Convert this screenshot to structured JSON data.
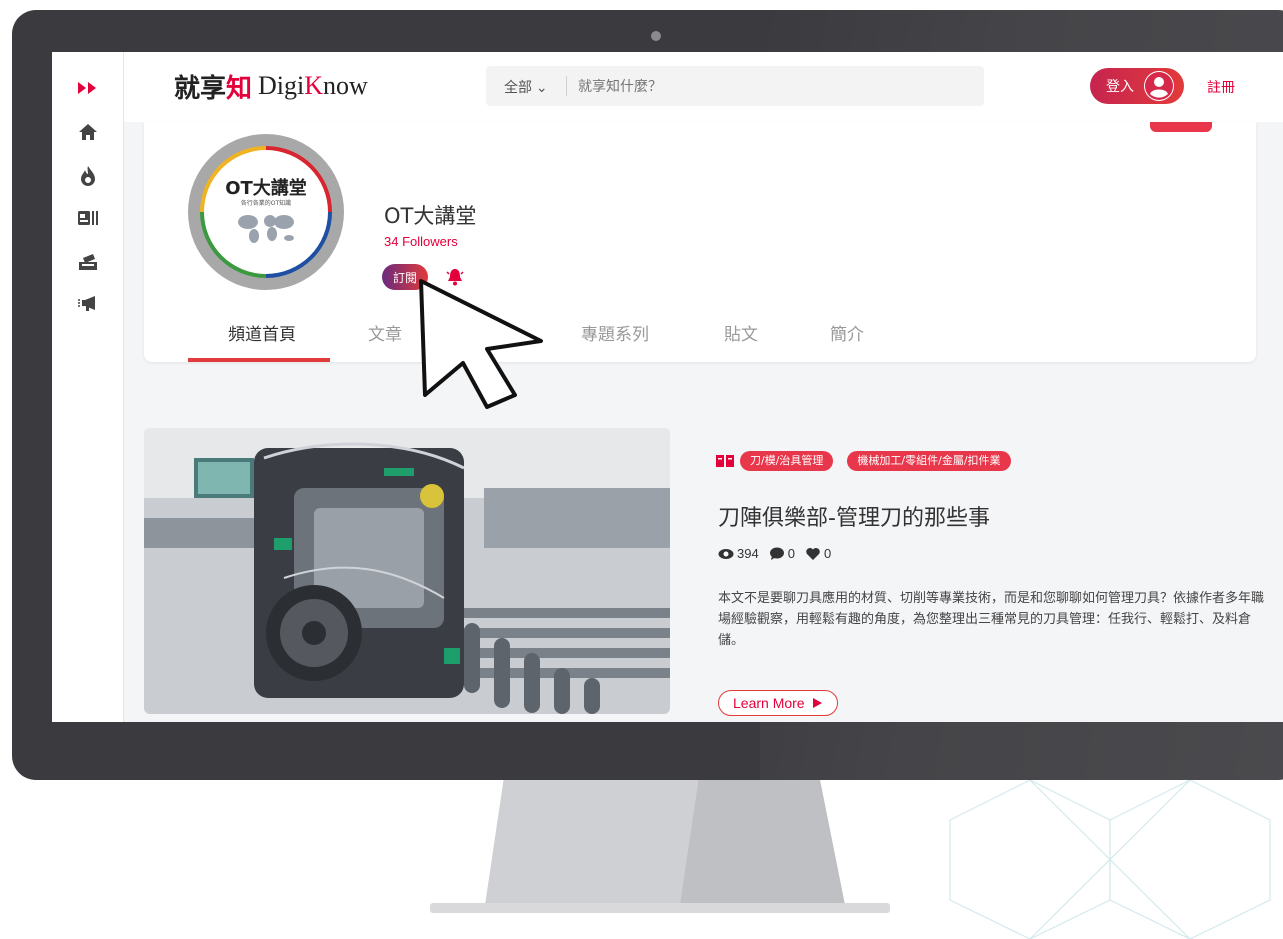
{
  "colors": {
    "accent": "#e4003a",
    "accent_button": "#e8364a",
    "subscribe_start": "#6a2a7d"
  },
  "brand": {
    "logo_cn_1": "就享",
    "logo_cn_2": "知",
    "logo_en_1": "Digi",
    "logo_en_k": "K",
    "logo_en_2": "now"
  },
  "sidebar": {
    "items": [
      {
        "icon": "double-chevron-right-icon"
      },
      {
        "icon": "home-icon"
      },
      {
        "icon": "fire-icon"
      },
      {
        "icon": "id-card-list-icon"
      },
      {
        "icon": "inbox-upload-icon"
      },
      {
        "icon": "megaphone-icon"
      }
    ]
  },
  "search": {
    "category": "全部 ⌄",
    "placeholder": "就享知什麼？",
    "icon": "search-icon"
  },
  "header": {
    "login_label": "登入",
    "register_label": "註冊",
    "avatar_icon": "user-circle-icon"
  },
  "channel": {
    "logo_text": "OT大講堂",
    "logo_subtext": "各行各業的OT知識",
    "name": "OT大講堂",
    "followers": "34 Followers",
    "subscribe_label": "訂閱",
    "bell_icon": "bell-icon"
  },
  "tabs": [
    "頻道首頁",
    "文章",
    "專題系列",
    "貼文",
    "簡介"
  ],
  "article": {
    "tag_icon": "book-icon",
    "tags": [
      "刀/模/治具管理",
      "機械加工/零組件/金屬/扣件業"
    ],
    "title": "刀陣俱樂部-管理刀的那些事",
    "views": "394",
    "comments": "0",
    "likes": "0",
    "excerpt": "本文不是要聊刀具應用的材質、切削等專業技術，而是和您聊聊如何管理刀具？依據作者多年職場經驗觀察，用輕鬆有趣的角度，為您整理出三種常見的刀具管理：任我行、輕鬆打、及料倉儲。",
    "learn_more": "Learn More"
  }
}
